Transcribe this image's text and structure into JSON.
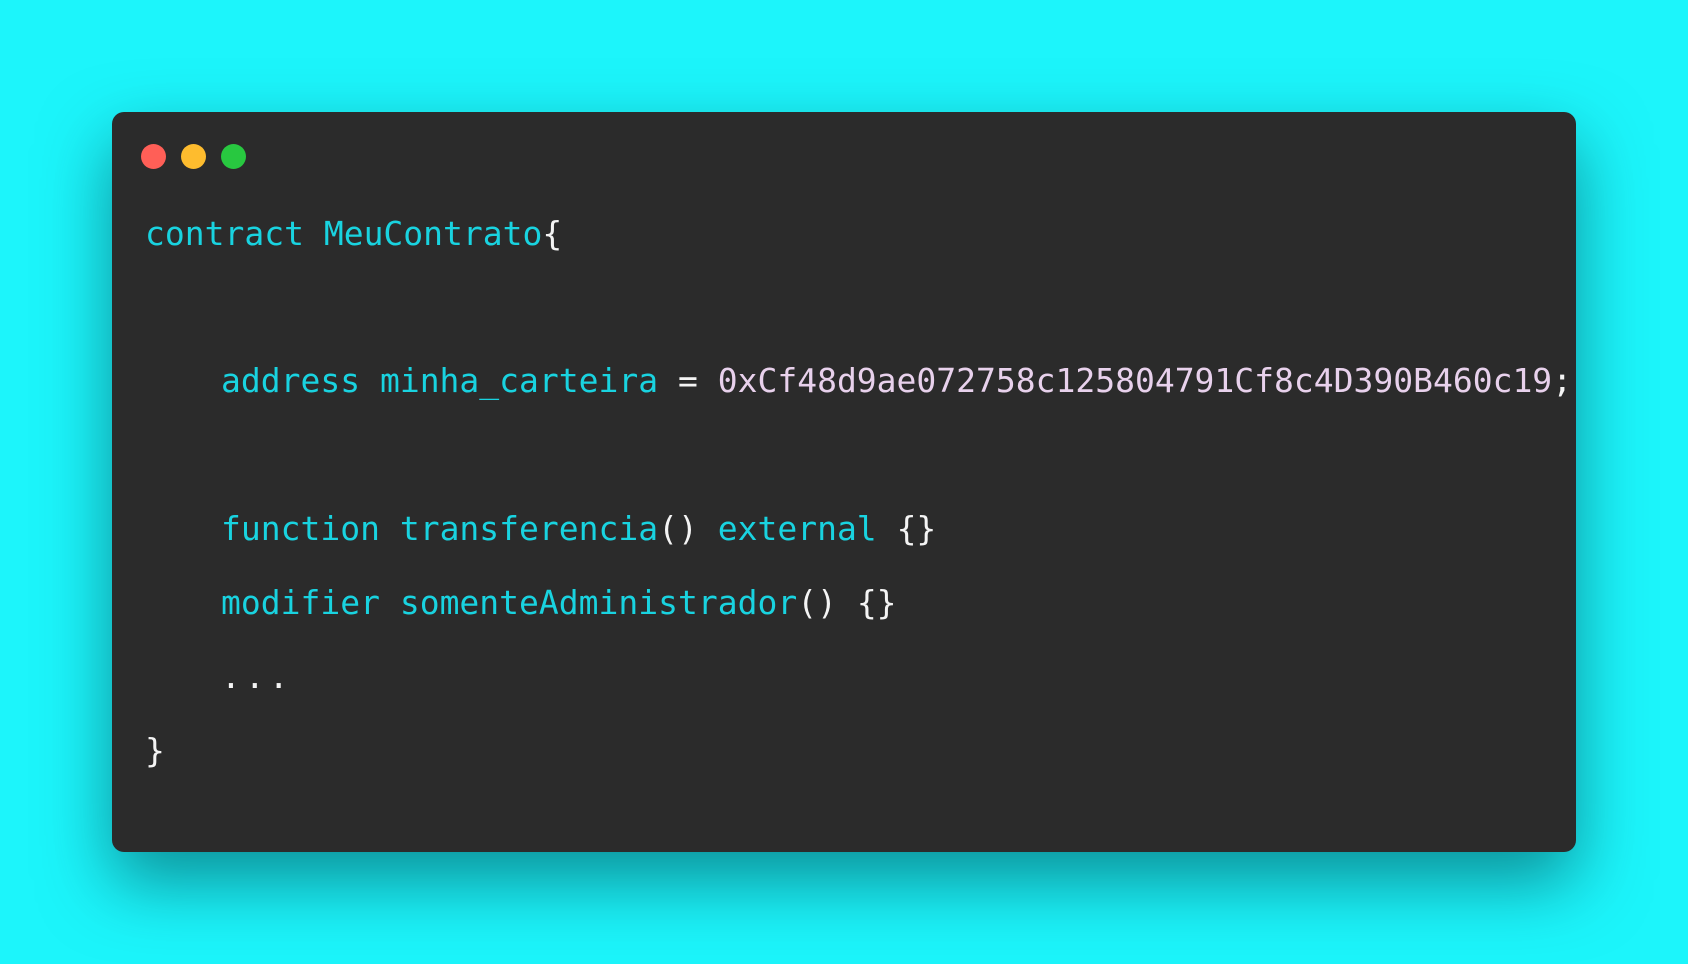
{
  "window": {
    "controls": [
      "close",
      "minimize",
      "maximize"
    ],
    "control_colors": {
      "close": "#ff5f57",
      "minimize": "#febc2e",
      "maximize": "#28c840"
    }
  },
  "code": {
    "line1": {
      "keyword": "contract",
      "name": "MeuContrato",
      "brace_open": "{"
    },
    "line2": {
      "type": "address",
      "name": "minha_carteira",
      "op": "=",
      "value": "0xCf48d9ae072758c125804791Cf8c4D390B460c19",
      "semicolon": ";"
    },
    "line3": {
      "keyword": "function",
      "name": "transferencia",
      "parens": "()",
      "modifier": "external",
      "body": "{}"
    },
    "line4": {
      "keyword": "modifier",
      "name": "somenteAdministrador",
      "parens": "()",
      "body": "{}"
    },
    "line5": {
      "ellipsis": "..."
    },
    "line6": {
      "brace_close": "}"
    }
  },
  "colors": {
    "background": "#1cf5fb",
    "editor_bg": "#2b2b2b",
    "keyword": "#19d3e0",
    "hex_literal": "#e8d1ec",
    "punctuation": "#f4f4f4"
  }
}
